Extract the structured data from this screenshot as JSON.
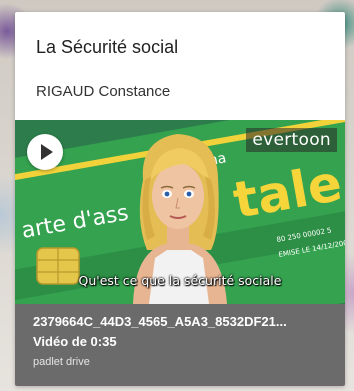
{
  "card": {
    "title": "La Sécurité social",
    "author": "RIGAUD Constance"
  },
  "video": {
    "watermark": "evertoon",
    "caption": "Qu'est ce que la sécurité sociale",
    "thumbnail_text": {
      "card_fragment_left": "arte d'ass",
      "card_fragment_top": "ma",
      "card_fragment_big": "tale",
      "card_number": "80 250 00002 5",
      "card_issue": "EMISE LE 14/12/200"
    },
    "colors": {
      "card_green": "#2f9a4a",
      "card_stripe": "#f2d23a",
      "hair": "#e9c25a"
    }
  },
  "attachment": {
    "file_name": "2379664C_44D3_4565_A5A3_8532DF21...",
    "duration": "Vidéo de 0:35",
    "source": "padlet drive"
  }
}
